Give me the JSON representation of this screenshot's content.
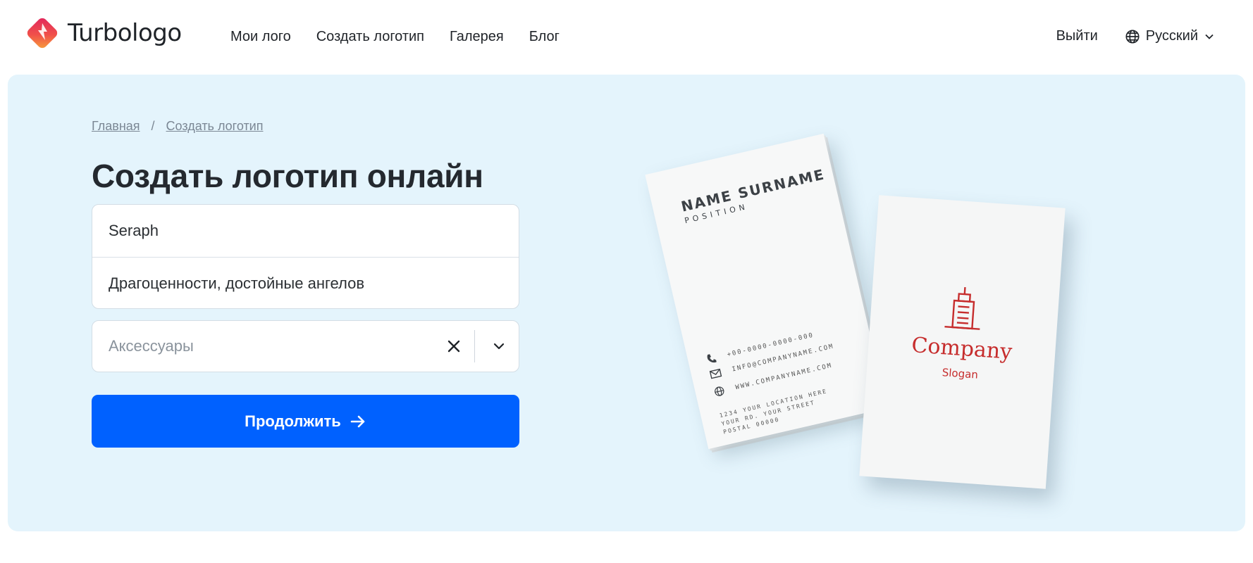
{
  "header": {
    "brand": "Turbologo",
    "nav": [
      "Мои лого",
      "Создать логотип",
      "Галерея",
      "Блог"
    ],
    "logout_label": "Выйти",
    "language_label": "Русский"
  },
  "hero": {
    "breadcrumbs": [
      "Главная",
      "Создать логотип"
    ],
    "breadcrumb_separator": "/",
    "title": "Создать логотип онлайн",
    "name_value": "Seraph",
    "slogan_value": "Драгоценности, достойные ангелов",
    "industry_placeholder": "Аксессуары",
    "continue_label": "Продолжить"
  },
  "illustration": {
    "card_front": {
      "name": "NAME SURNAME",
      "position": "POSITION",
      "phone": "+00-0000-0000-000",
      "email": "INFO@COMPANYNAME.COM",
      "website": "WWW.COMPANYNAME.COM",
      "address": [
        "1234 YOUR LOCATION HERE",
        "YOUR RD. YOUR STREET",
        "POSTAL 00000"
      ]
    },
    "card_back": {
      "company": "Company",
      "slogan": "Slogan"
    }
  },
  "colors": {
    "accent": "#0061ff",
    "hero_bg": "#e4f4fc",
    "logo_red": "#c62d2d"
  },
  "icons": [
    "turbologo-logo",
    "globe-icon",
    "chevron-down-icon",
    "close-icon",
    "arrow-right-icon",
    "phone-icon",
    "mail-icon",
    "web-icon",
    "building-icon"
  ]
}
